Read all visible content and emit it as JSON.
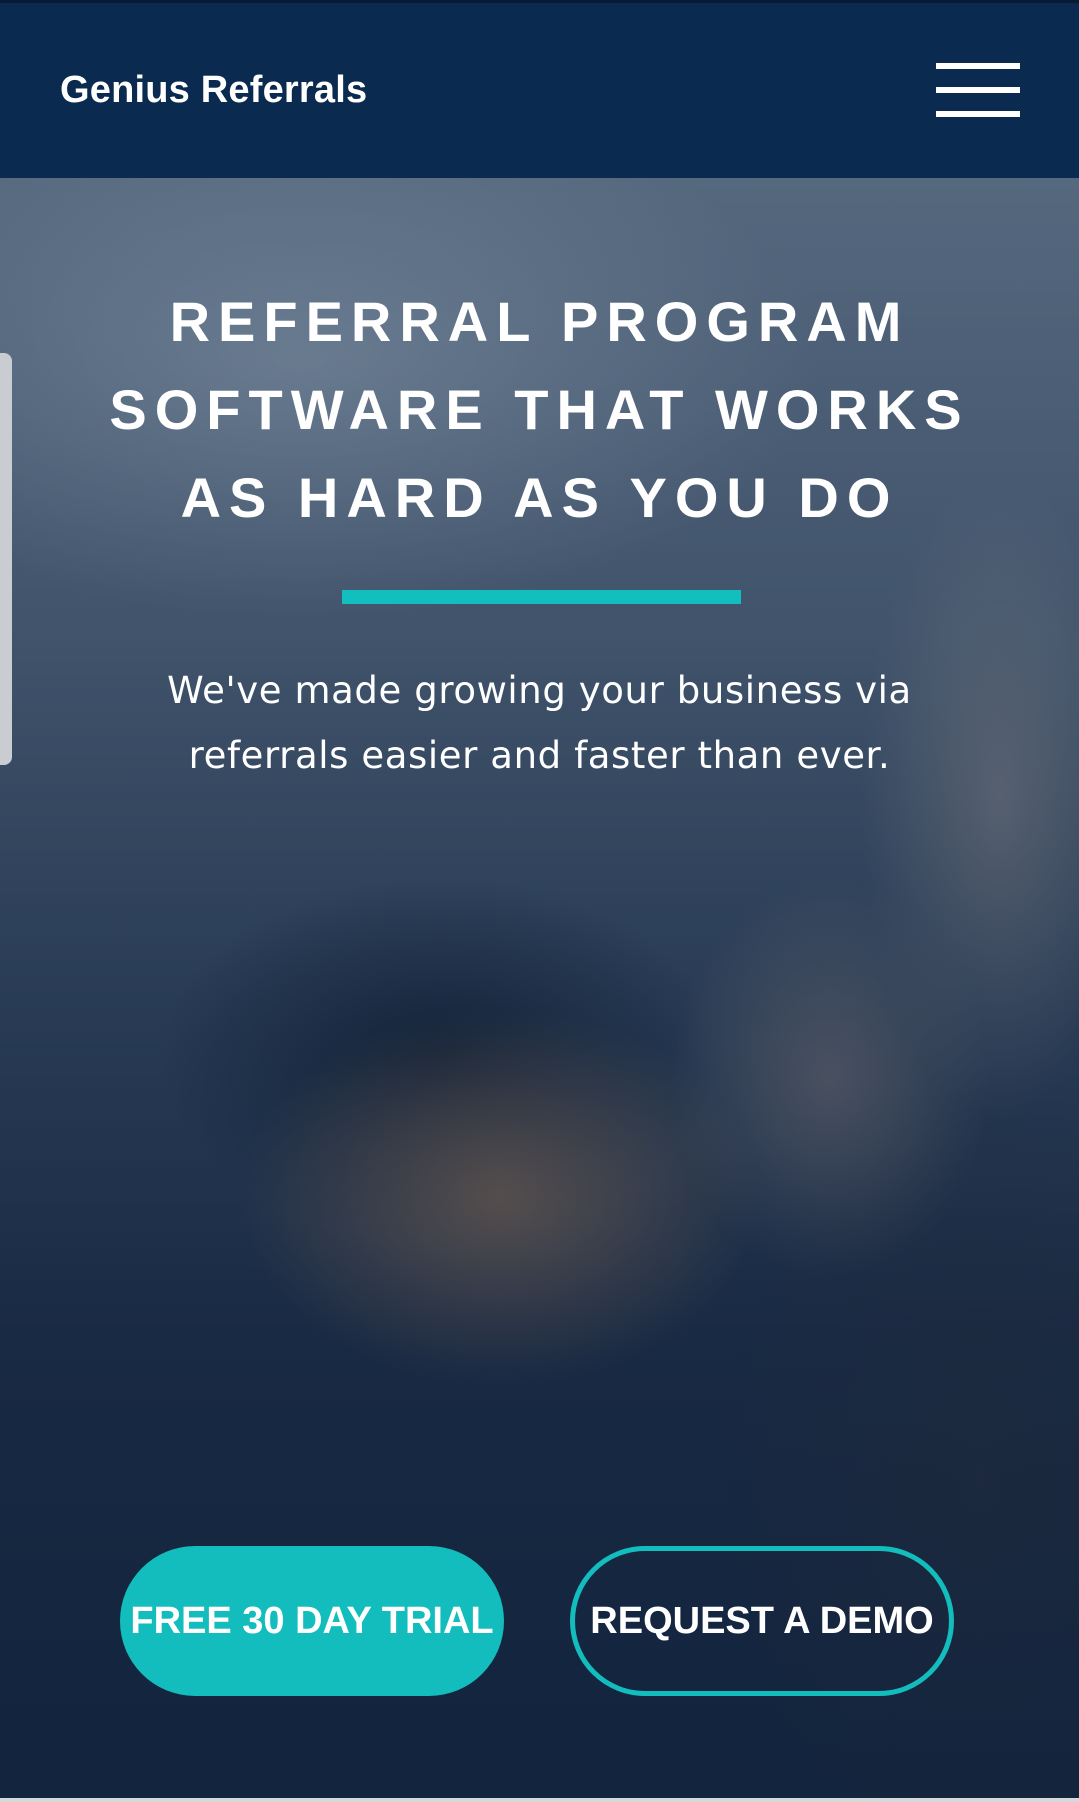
{
  "header": {
    "brand": "Genius Referrals",
    "menu_icon": "hamburger-menu-icon"
  },
  "hero": {
    "title_lines": [
      "REFERRAL PROGRAM",
      "SOFTWARE THAT WORKS",
      "AS HARD AS YOU DO"
    ],
    "subtitle_lines": [
      "We've made growing your business via",
      "referrals easier and faster than ever."
    ],
    "primary_cta": "FREE 30 DAY TRIAL",
    "secondary_cta": "REQUEST A DEMO"
  },
  "colors": {
    "header_bg": "#0b2a4f",
    "accent": "#13bdbd",
    "text": "#ffffff"
  }
}
